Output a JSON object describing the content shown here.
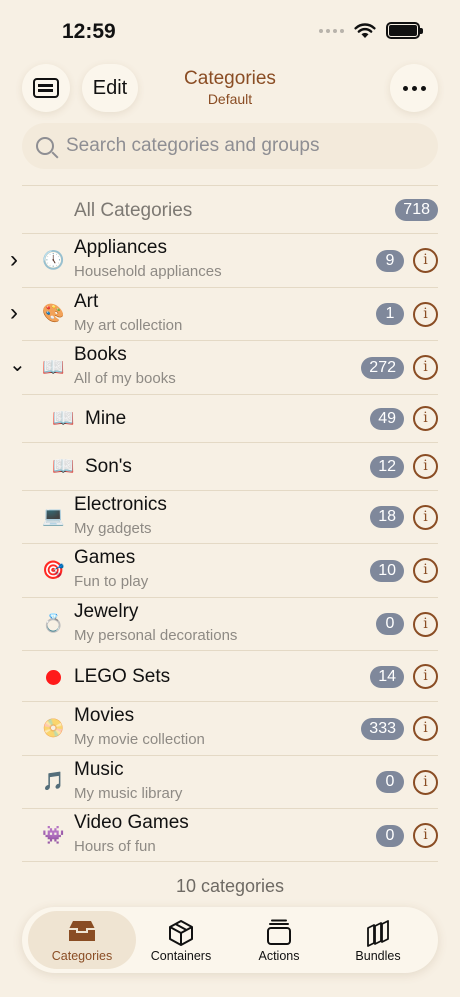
{
  "status_bar": {
    "time": "12:59"
  },
  "header": {
    "edit_label": "Edit",
    "title": "Categories",
    "subtitle": "Default"
  },
  "search": {
    "placeholder": "Search categories and groups"
  },
  "all_categories": {
    "label": "All Categories",
    "count": "718"
  },
  "rows": [
    {
      "name": "Appliances",
      "description": "Household appliances",
      "count": "9",
      "icon": "clock-icon",
      "glyph": "🕔",
      "chevron": "›"
    },
    {
      "name": "Art",
      "description": "My art collection",
      "count": "1",
      "icon": "palette-icon",
      "glyph": "🎨",
      "chevron": "›"
    },
    {
      "name": "Books",
      "description": "All of my books",
      "count": "272",
      "icon": "book-icon",
      "glyph": "📖",
      "chevron": "⌄"
    },
    {
      "name": "Mine",
      "count": "49",
      "icon": "book-icon",
      "glyph": "📖"
    },
    {
      "name": "Son's",
      "count": "12",
      "icon": "book-icon",
      "glyph": "📖"
    },
    {
      "name": "Electronics",
      "description": "My gadgets",
      "count": "18",
      "icon": "laptop-icon",
      "glyph": "💻"
    },
    {
      "name": "Games",
      "description": "Fun to play",
      "count": "10",
      "icon": "target-icon",
      "glyph": "🎯"
    },
    {
      "name": "Jewelry",
      "description": "My personal decorations",
      "count": "0",
      "icon": "ring-icon",
      "glyph": "💍"
    },
    {
      "name": "LEGO Sets",
      "count": "14",
      "icon": "red-dot-icon",
      "color": "#ff1a1a"
    },
    {
      "name": "Movies",
      "description": "My movie collection",
      "count": "333",
      "icon": "disc-icon",
      "glyph": "📀"
    },
    {
      "name": "Music",
      "description": "My music library",
      "count": "0",
      "icon": "music-note-icon",
      "glyph": "🎵"
    },
    {
      "name": "Video Games",
      "description": "Hours of fun",
      "count": "0",
      "icon": "space-invader-icon",
      "glyph": "👾"
    }
  ],
  "info_glyph": "i",
  "footer": {
    "count_text": "10 categories"
  },
  "tabbar": {
    "tabs": [
      {
        "label": "Categories",
        "icon": "tray-icon",
        "active": true
      },
      {
        "label": "Containers",
        "icon": "box-icon",
        "active": false
      },
      {
        "label": "Actions",
        "icon": "stack-icon",
        "active": false
      },
      {
        "label": "Bundles",
        "icon": "bundles-icon",
        "active": false
      }
    ]
  },
  "colors": {
    "background": "#f7f0e4",
    "accent": "#8a4d24",
    "badge": "#7f889b"
  }
}
